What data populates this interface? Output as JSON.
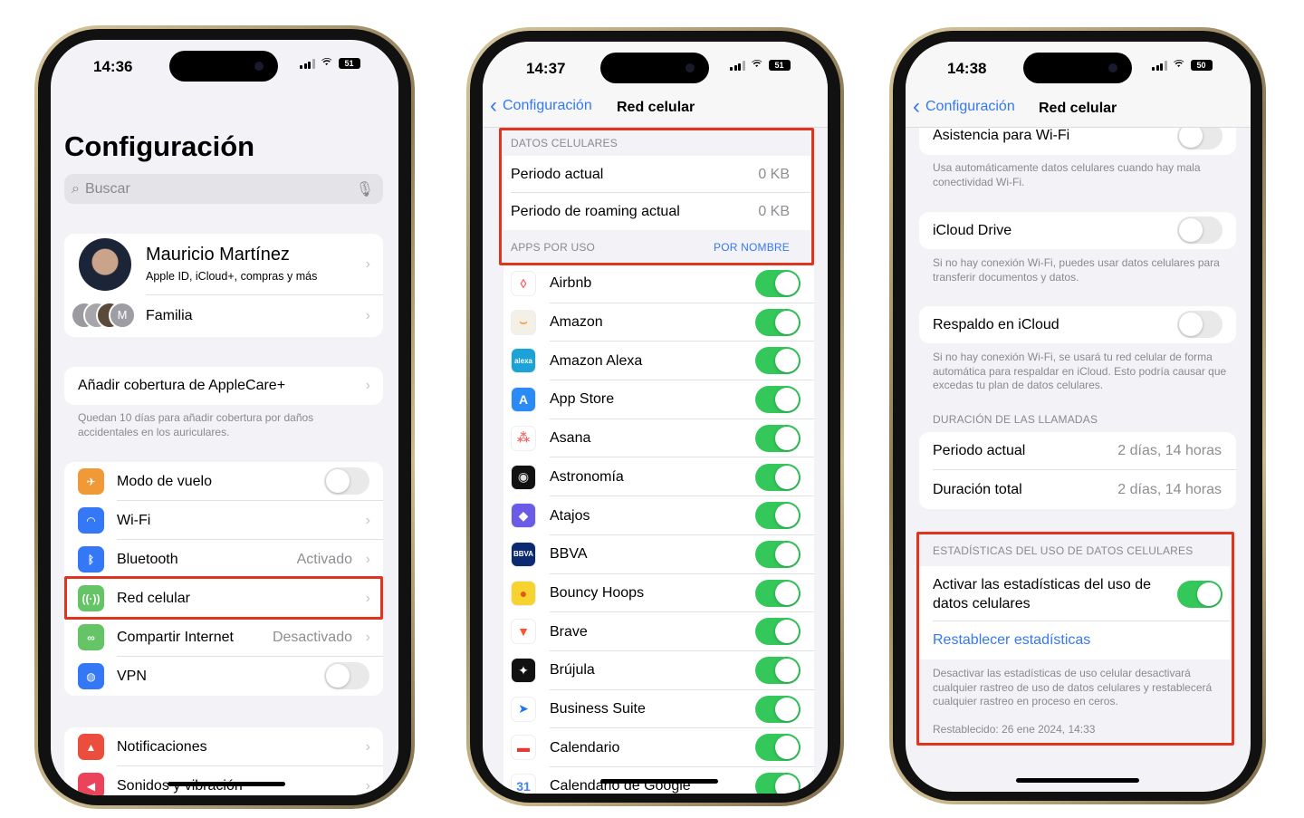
{
  "phone1": {
    "time": "14:36",
    "battery": "51",
    "title": "Configuración",
    "search_placeholder": "Buscar",
    "profile": {
      "name": "Mauricio Martínez",
      "subtitle": "Apple ID, iCloud+, compras y más",
      "family": "Familia",
      "family_initial": "M"
    },
    "applecare": {
      "label": "Añadir cobertura de AppleCare+",
      "footer": "Quedan 10 días para añadir cobertura por daños accidentales en los auriculares."
    },
    "settings": [
      {
        "label": "Modo de vuelo",
        "icon": "airplane-icon",
        "color": "#f09a37",
        "toggle": false
      },
      {
        "label": "Wi-Fi",
        "icon": "wifi-icon",
        "color": "#3478f6",
        "value": ""
      },
      {
        "label": "Bluetooth",
        "icon": "bluetooth-icon",
        "color": "#3478f6",
        "value": "Activado"
      },
      {
        "label": "Red celular",
        "icon": "antenna-icon",
        "color": "#65c466",
        "value": ""
      },
      {
        "label": "Compartir Internet",
        "icon": "link-icon",
        "color": "#65c466",
        "value": "Desactivado"
      },
      {
        "label": "VPN",
        "icon": "globe-icon",
        "color": "#3478f6",
        "toggle": false
      }
    ],
    "more": [
      {
        "label": "Notificaciones",
        "icon": "bell-icon",
        "color": "#eb4e3d"
      },
      {
        "label": "Sonidos y vibración",
        "icon": "speaker-icon",
        "color": "#eb445a"
      }
    ]
  },
  "phone2": {
    "time": "14:37",
    "battery": "51",
    "back": "Configuración",
    "title": "Red celular",
    "data_header": "DATOS CELULARES",
    "data_rows": [
      {
        "label": "Periodo actual",
        "value": "0 KB"
      },
      {
        "label": "Periodo de roaming actual",
        "value": "0 KB"
      }
    ],
    "apps_header": "APPS POR USO",
    "sort_label": "POR NOMBRE",
    "apps": [
      {
        "label": "Airbnb",
        "icon": "airbnb-icon",
        "bg": "#ffffff",
        "fg": "#ff5a5f",
        "glyph": "◊",
        "on": true
      },
      {
        "label": "Amazon",
        "icon": "amazon-icon",
        "bg": "#f4f0e6",
        "fg": "#f19e39",
        "glyph": "⌣",
        "on": true
      },
      {
        "label": "Amazon Alexa",
        "icon": "alexa-icon",
        "bg": "#1ba3d8",
        "fg": "#ffffff",
        "glyph": "alexa",
        "on": true
      },
      {
        "label": "App Store",
        "icon": "app-store-icon",
        "bg": "#2a8af6",
        "fg": "#ffffff",
        "glyph": "A",
        "on": true
      },
      {
        "label": "Asana",
        "icon": "asana-icon",
        "bg": "#ffffff",
        "fg": "#f06a6a",
        "glyph": "⁂",
        "on": true
      },
      {
        "label": "Astronomía",
        "icon": "astronomy-icon",
        "bg": "#111111",
        "fg": "#dddddd",
        "glyph": "◉",
        "on": true
      },
      {
        "label": "Atajos",
        "icon": "shortcuts-icon",
        "bg": "#6b5ce7",
        "fg": "#ffffff",
        "glyph": "◆",
        "on": true
      },
      {
        "label": "BBVA",
        "icon": "bbva-icon",
        "bg": "#0b2a6f",
        "fg": "#ffffff",
        "glyph": "BBVA",
        "on": true
      },
      {
        "label": "Bouncy Hoops",
        "icon": "bouncy-hoops-icon",
        "bg": "#f6d32d",
        "fg": "#e2581d",
        "glyph": "●",
        "on": true
      },
      {
        "label": "Brave",
        "icon": "brave-icon",
        "bg": "#ffffff",
        "fg": "#fb542b",
        "glyph": "▼",
        "on": true
      },
      {
        "label": "Brújula",
        "icon": "compass-icon",
        "bg": "#111111",
        "fg": "#ffffff",
        "glyph": "✦",
        "on": true
      },
      {
        "label": "Business Suite",
        "icon": "business-suite-icon",
        "bg": "#ffffff",
        "fg": "#1877f2",
        "glyph": "➤",
        "on": true
      },
      {
        "label": "Calendario",
        "icon": "calendar-icon",
        "bg": "#ffffff",
        "fg": "#e53935",
        "glyph": "▬",
        "on": true
      },
      {
        "label": "Calendario de Google",
        "icon": "google-calendar-icon",
        "bg": "#ffffff",
        "fg": "#4285f4",
        "glyph": "31",
        "on": true
      }
    ]
  },
  "phone3": {
    "time": "14:38",
    "battery": "50",
    "back": "Configuración",
    "title": "Red celular",
    "wifi_assist": {
      "label": "Asistencia para Wi-Fi",
      "on": false,
      "footer": "Usa automáticamente datos celulares cuando hay mala conectividad Wi-Fi."
    },
    "icloud_drive": {
      "label": "iCloud Drive",
      "on": false,
      "footer": "Si no hay conexión Wi-Fi, puedes usar datos celulares para transferir documentos y datos."
    },
    "icloud_backup": {
      "label": "Respaldo en iCloud",
      "on": false,
      "footer": "Si no hay conexión Wi-Fi, se usará tu red celular de forma automática para respaldar en iCloud. Esto podría causar que excedas tu plan de datos celulares."
    },
    "calls_header": "DURACIÓN DE LAS LLAMADAS",
    "calls": [
      {
        "label": "Periodo actual",
        "value": "2 días, 14 horas"
      },
      {
        "label": "Duración total",
        "value": "2 días, 14 horas"
      }
    ],
    "stats_header": "ESTADÍSTICAS DEL USO DE DATOS CELULARES",
    "stats_toggle": {
      "label": "Activar las estadísticas del uso de datos celulares",
      "on": true
    },
    "reset_label": "Restablecer estadísticas",
    "stats_footer": "Desactivar las estadísticas de uso celular desactivará cualquier rastreo de uso de datos celulares y restablecerá cualquier rastreo en proceso en ceros.",
    "reset_date": "Restablecido: 26 ene 2024, 14:33"
  },
  "colors": {
    "highlight": "#e2331f",
    "accent": "#3478f6",
    "toggle_on": "#34c759"
  }
}
